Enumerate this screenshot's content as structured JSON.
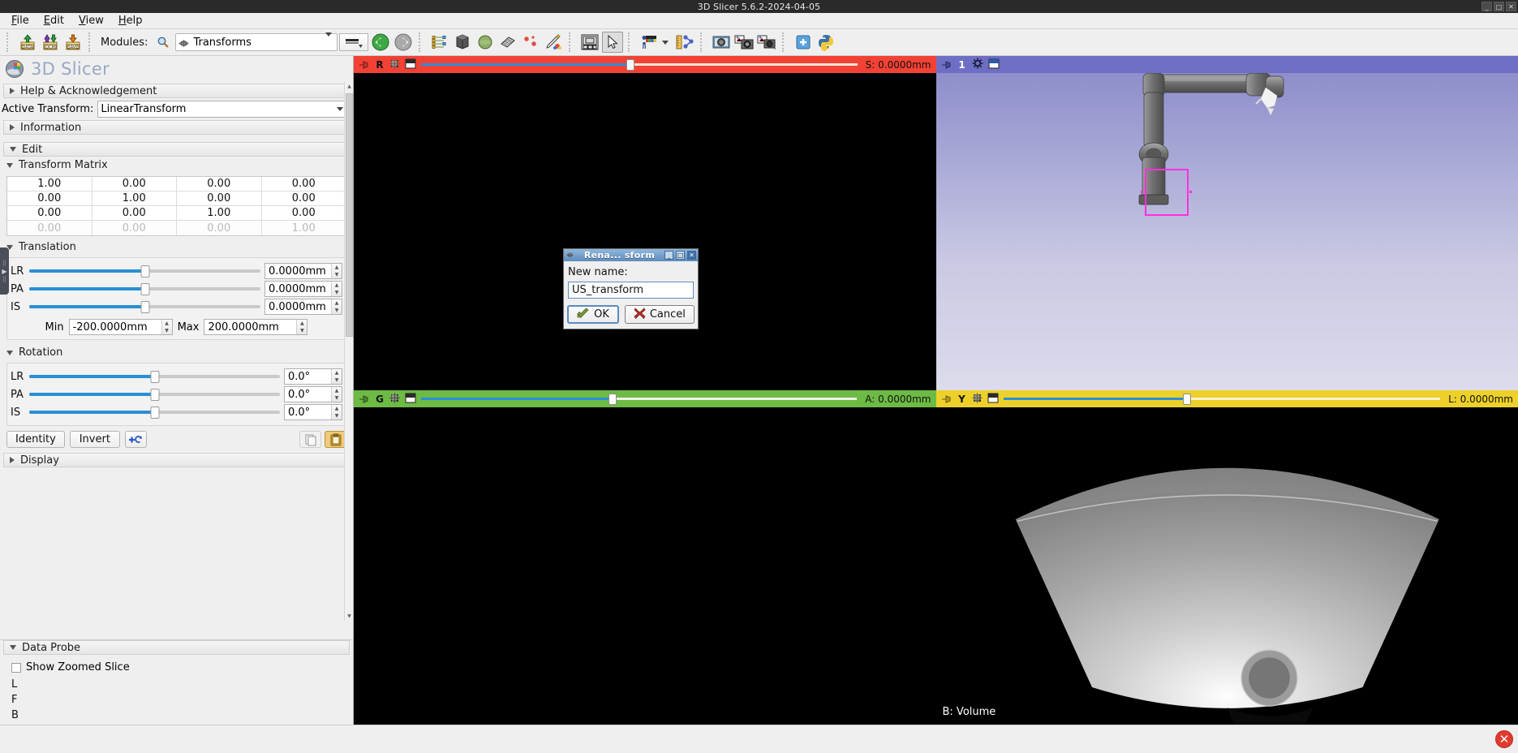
{
  "window": {
    "title": "3D Slicer 5.6.2-2024-04-05",
    "min": "_",
    "max": "□",
    "close": "✕"
  },
  "menubar": {
    "items": [
      "File",
      "Edit",
      "View",
      "Help"
    ]
  },
  "toolbar": {
    "modules_label": "Modules:",
    "search_icon": "search-icon",
    "module_selected": "Transforms",
    "icons": [
      "load-data-icon",
      "load-dicom-icon",
      "save-data-icon",
      "module-favorites-icon",
      "previous-module-icon",
      "next-module-icon",
      "subject-hierarchy-icon",
      "volume-rendering-icon",
      "models-icon",
      "segmentations-icon",
      "markups-icon",
      "annotations-icon",
      "layout-icon",
      "mouse-mode-pointer-icon",
      "color-icon",
      "ruler-markups-icon",
      "screenshot-icon",
      "scene-views-icon",
      "capture-icon",
      "extensions-icon",
      "python-console-icon"
    ]
  },
  "branding": {
    "name": "3D Slicer",
    "logo": "slicer-logo-icon"
  },
  "module_panel": {
    "help_section": "Help & Acknowledgement",
    "active_transform_label": "Active Transform:",
    "active_transform_value": "LinearTransform",
    "information_section": "Information",
    "edit_section": "Edit",
    "transform_matrix_section": "Transform Matrix",
    "matrix": [
      [
        "1.00",
        "0.00",
        "0.00",
        "0.00"
      ],
      [
        "0.00",
        "1.00",
        "0.00",
        "0.00"
      ],
      [
        "0.00",
        "0.00",
        "1.00",
        "0.00"
      ],
      [
        "0.00",
        "0.00",
        "0.00",
        "1.00"
      ]
    ],
    "translation_section": "Translation",
    "translation": [
      {
        "axis": "LR",
        "value": "0.0000mm",
        "pct": 50
      },
      {
        "axis": "PA",
        "value": "0.0000mm",
        "pct": 50
      },
      {
        "axis": "IS",
        "value": "0.0000mm",
        "pct": 50
      }
    ],
    "min_label": "Min",
    "min_value": "-200.0000mm",
    "max_label": "Max",
    "max_value": "200.0000mm",
    "rotation_section": "Rotation",
    "rotation": [
      {
        "axis": "LR",
        "value": "0.0°",
        "pct": 50
      },
      {
        "axis": "PA",
        "value": "0.0°",
        "pct": 50
      },
      {
        "axis": "IS",
        "value": "0.0°",
        "pct": 50
      }
    ],
    "identity_button": "Identity",
    "invert_button": "Invert",
    "split_button_icon": "split-transform-icon",
    "copy_button_icon": "copy-icon",
    "paste_button_icon": "paste-icon",
    "display_section": "Display"
  },
  "data_probe": {
    "section": "Data Probe",
    "show_zoomed_slice_label": "Show Zoomed Slice",
    "show_zoomed_slice_checked": false,
    "lines": [
      "L",
      "F",
      "B"
    ]
  },
  "views": {
    "red": {
      "pin_icon": "pin-icon",
      "label": "R",
      "visibility_icon": "slice-visibility-icon",
      "layout_icon": "slice-layout-icon",
      "offset_text": "S: 0.0000mm",
      "slider_pct": 48
    },
    "green": {
      "pin_icon": "pin-icon",
      "label": "G",
      "visibility_icon": "slice-visibility-icon",
      "layout_icon": "slice-layout-icon",
      "offset_text": "A: 0.0000mm",
      "slider_pct": 44
    },
    "yellow": {
      "pin_icon": "pin-icon",
      "label": "Y",
      "visibility_icon": "slice-visibility-icon",
      "layout_icon": "slice-layout-icon",
      "offset_text": "L: 0.0000mm",
      "slider_pct": 42
    },
    "threeD": {
      "pin_icon": "pin-icon",
      "label": "1",
      "settings_icon": "gear-icon",
      "maximize_icon": "maximize-view-icon",
      "scene_description": "robotic-ultrasound-probe-arm"
    },
    "volume": {
      "corner_label": "B: Volume",
      "scene_description": "ultrasound-fan-volume-render"
    }
  },
  "dialog": {
    "title": "Rena...  sform",
    "icon": "transform-icon",
    "min_btn": "_",
    "max_btn": "□",
    "close_btn": "✕",
    "label": "New name:",
    "input_value": "US_transform",
    "ok_button": "OK",
    "cancel_button": "Cancel",
    "ok_icon": "ok-check-icon",
    "cancel_icon": "cancel-x-icon"
  },
  "statusbar": {
    "error_icon": "error-badge-icon",
    "error_glyph": "✕"
  },
  "colors": {
    "red_slice": "#f34235",
    "green_slice": "#6dbb45",
    "yellow_slice": "#edd12a",
    "threeD_bar": "#6e6fc4",
    "slider_fill": "#2a8fd4",
    "magenta_roi": "#ff2fe0",
    "brand_text": "#9aa8c4"
  }
}
